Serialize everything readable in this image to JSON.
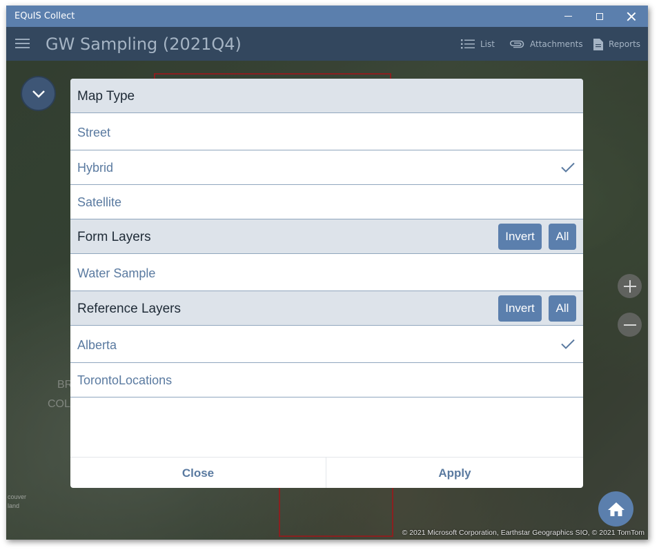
{
  "window": {
    "title": "EQuIS Collect"
  },
  "header": {
    "title": "GW Sampling (2021Q4)",
    "tools": [
      {
        "label": "List",
        "icon": "list-icon"
      },
      {
        "label": "Attachments",
        "icon": "paperclip-icon"
      },
      {
        "label": "Reports",
        "icon": "document-icon"
      }
    ]
  },
  "map": {
    "labels": [
      "BR",
      "COL",
      "couver",
      "land"
    ],
    "copyright": "© 2021 Microsoft Corporation, Earthstar Geographics SIO, © 2021 TomTom"
  },
  "dialog": {
    "map_type": {
      "title": "Map Type",
      "options": [
        {
          "label": "Street",
          "checked": false
        },
        {
          "label": "Hybrid",
          "checked": true
        },
        {
          "label": "Satellite",
          "checked": false
        }
      ]
    },
    "form_layers": {
      "title": "Form Layers",
      "invert_label": "Invert",
      "all_label": "All",
      "items": [
        {
          "label": "Water Sample",
          "checked": false
        }
      ]
    },
    "reference_layers": {
      "title": "Reference Layers",
      "invert_label": "Invert",
      "all_label": "All",
      "items": [
        {
          "label": "Alberta",
          "checked": true
        },
        {
          "label": "TorontoLocations",
          "checked": false
        }
      ]
    },
    "close_label": "Close",
    "apply_label": "Apply"
  },
  "colors": {
    "titlebar": "#5b7fad",
    "appbar": "#33475e",
    "accent": "#5b7fad",
    "link_text": "#5a7aa0",
    "section_bg": "#dde3ea"
  }
}
